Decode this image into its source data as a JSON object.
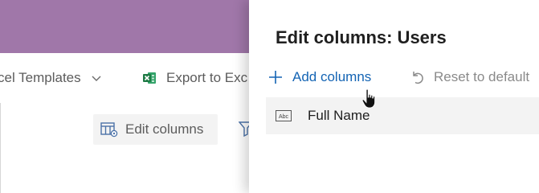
{
  "app": {
    "toolbar": {
      "templates_label": "cel Templates",
      "export_label": "Export to Exc",
      "edit_columns_label": "Edit columns"
    }
  },
  "panel": {
    "title": "Edit columns: Users",
    "add_columns_label": "Add columns",
    "reset_label": "Reset to default",
    "columns": [
      {
        "name": "Full Name",
        "type_icon": "text-type-icon"
      }
    ]
  },
  "colors": {
    "header_purple": "#a077a9",
    "link_blue": "#1464b4",
    "excel_green": "#1f7a45"
  }
}
